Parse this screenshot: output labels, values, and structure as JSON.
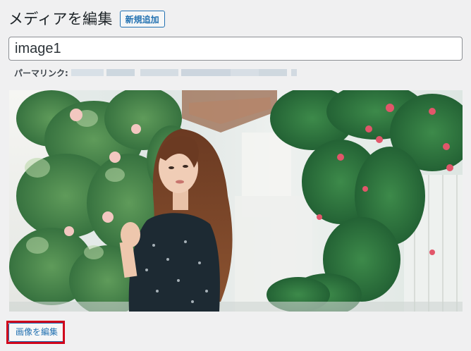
{
  "header": {
    "title": "メディアを編集",
    "add_new_label": "新規追加"
  },
  "attachment": {
    "title_value": "image1",
    "permalink_label": "パーマリンク:"
  },
  "image": {
    "alt": "photo"
  },
  "actions": {
    "edit_image_label": "画像を編集"
  },
  "colors": {
    "accent": "#2271b1",
    "highlight": "#d0021b",
    "background": "#f0f0f1"
  }
}
